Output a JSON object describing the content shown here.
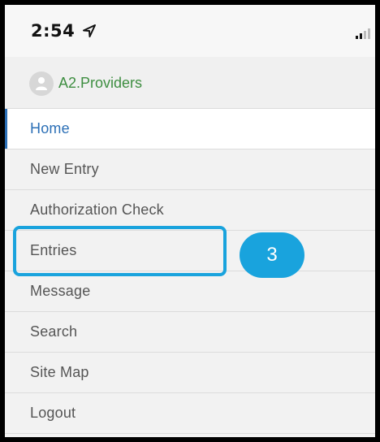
{
  "status_bar": {
    "time": "2:54",
    "location_icon": "location-arrow-icon",
    "signal_icon": "cellular-signal-icon"
  },
  "menu": {
    "user": {
      "name": "A2.Providers",
      "icon": "user-avatar-icon"
    },
    "items": [
      {
        "label": "Home",
        "active": true
      },
      {
        "label": "New Entry"
      },
      {
        "label": "Authorization Check"
      },
      {
        "label": "Entries"
      },
      {
        "label": "Message"
      },
      {
        "label": "Search"
      },
      {
        "label": "Site Map"
      },
      {
        "label": "Logout"
      }
    ]
  },
  "annotation": {
    "step_number": "3",
    "color": "#19a3dd"
  },
  "colors": {
    "active": "#2b6fb6",
    "user_name": "#3e8e41"
  }
}
